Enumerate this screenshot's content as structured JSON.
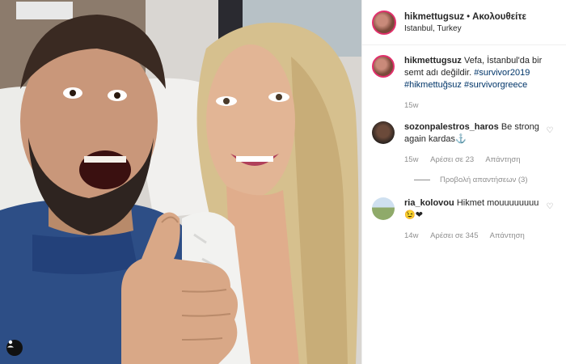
{
  "post": {
    "username": "hikmettugsuz",
    "follow_label": "Ακολουθείτε",
    "location": "Istanbul, Turkey"
  },
  "caption": {
    "username": "hikmettugsuz",
    "text": "Vefa, İstanbul'da bir semt adı değildir.",
    "tag1": "#survivor2019",
    "tag2": "#hikmettuğsuz",
    "tag3": "#survivorgreece",
    "time": "15w"
  },
  "comments": [
    {
      "username": "sozonpalestros_haros",
      "text": "Be strong again kardas⚓",
      "time": "15w",
      "likes": "Αρέσει σε 23",
      "reply": "Απάντηση",
      "view_replies": "Προβολή απαντήσεων (3)"
    },
    {
      "username": "ria_kolovou",
      "text": "Hikmet mouuuuuuuu😉❤",
      "time": "14w",
      "likes": "Αρέσει σε 345",
      "reply": "Απάντηση"
    }
  ],
  "colors": {
    "link": "#003569",
    "muted": "#8e8e8e",
    "text": "#262626"
  },
  "icons": {
    "like": "heart-icon",
    "user_tag": "user-tag-icon"
  }
}
